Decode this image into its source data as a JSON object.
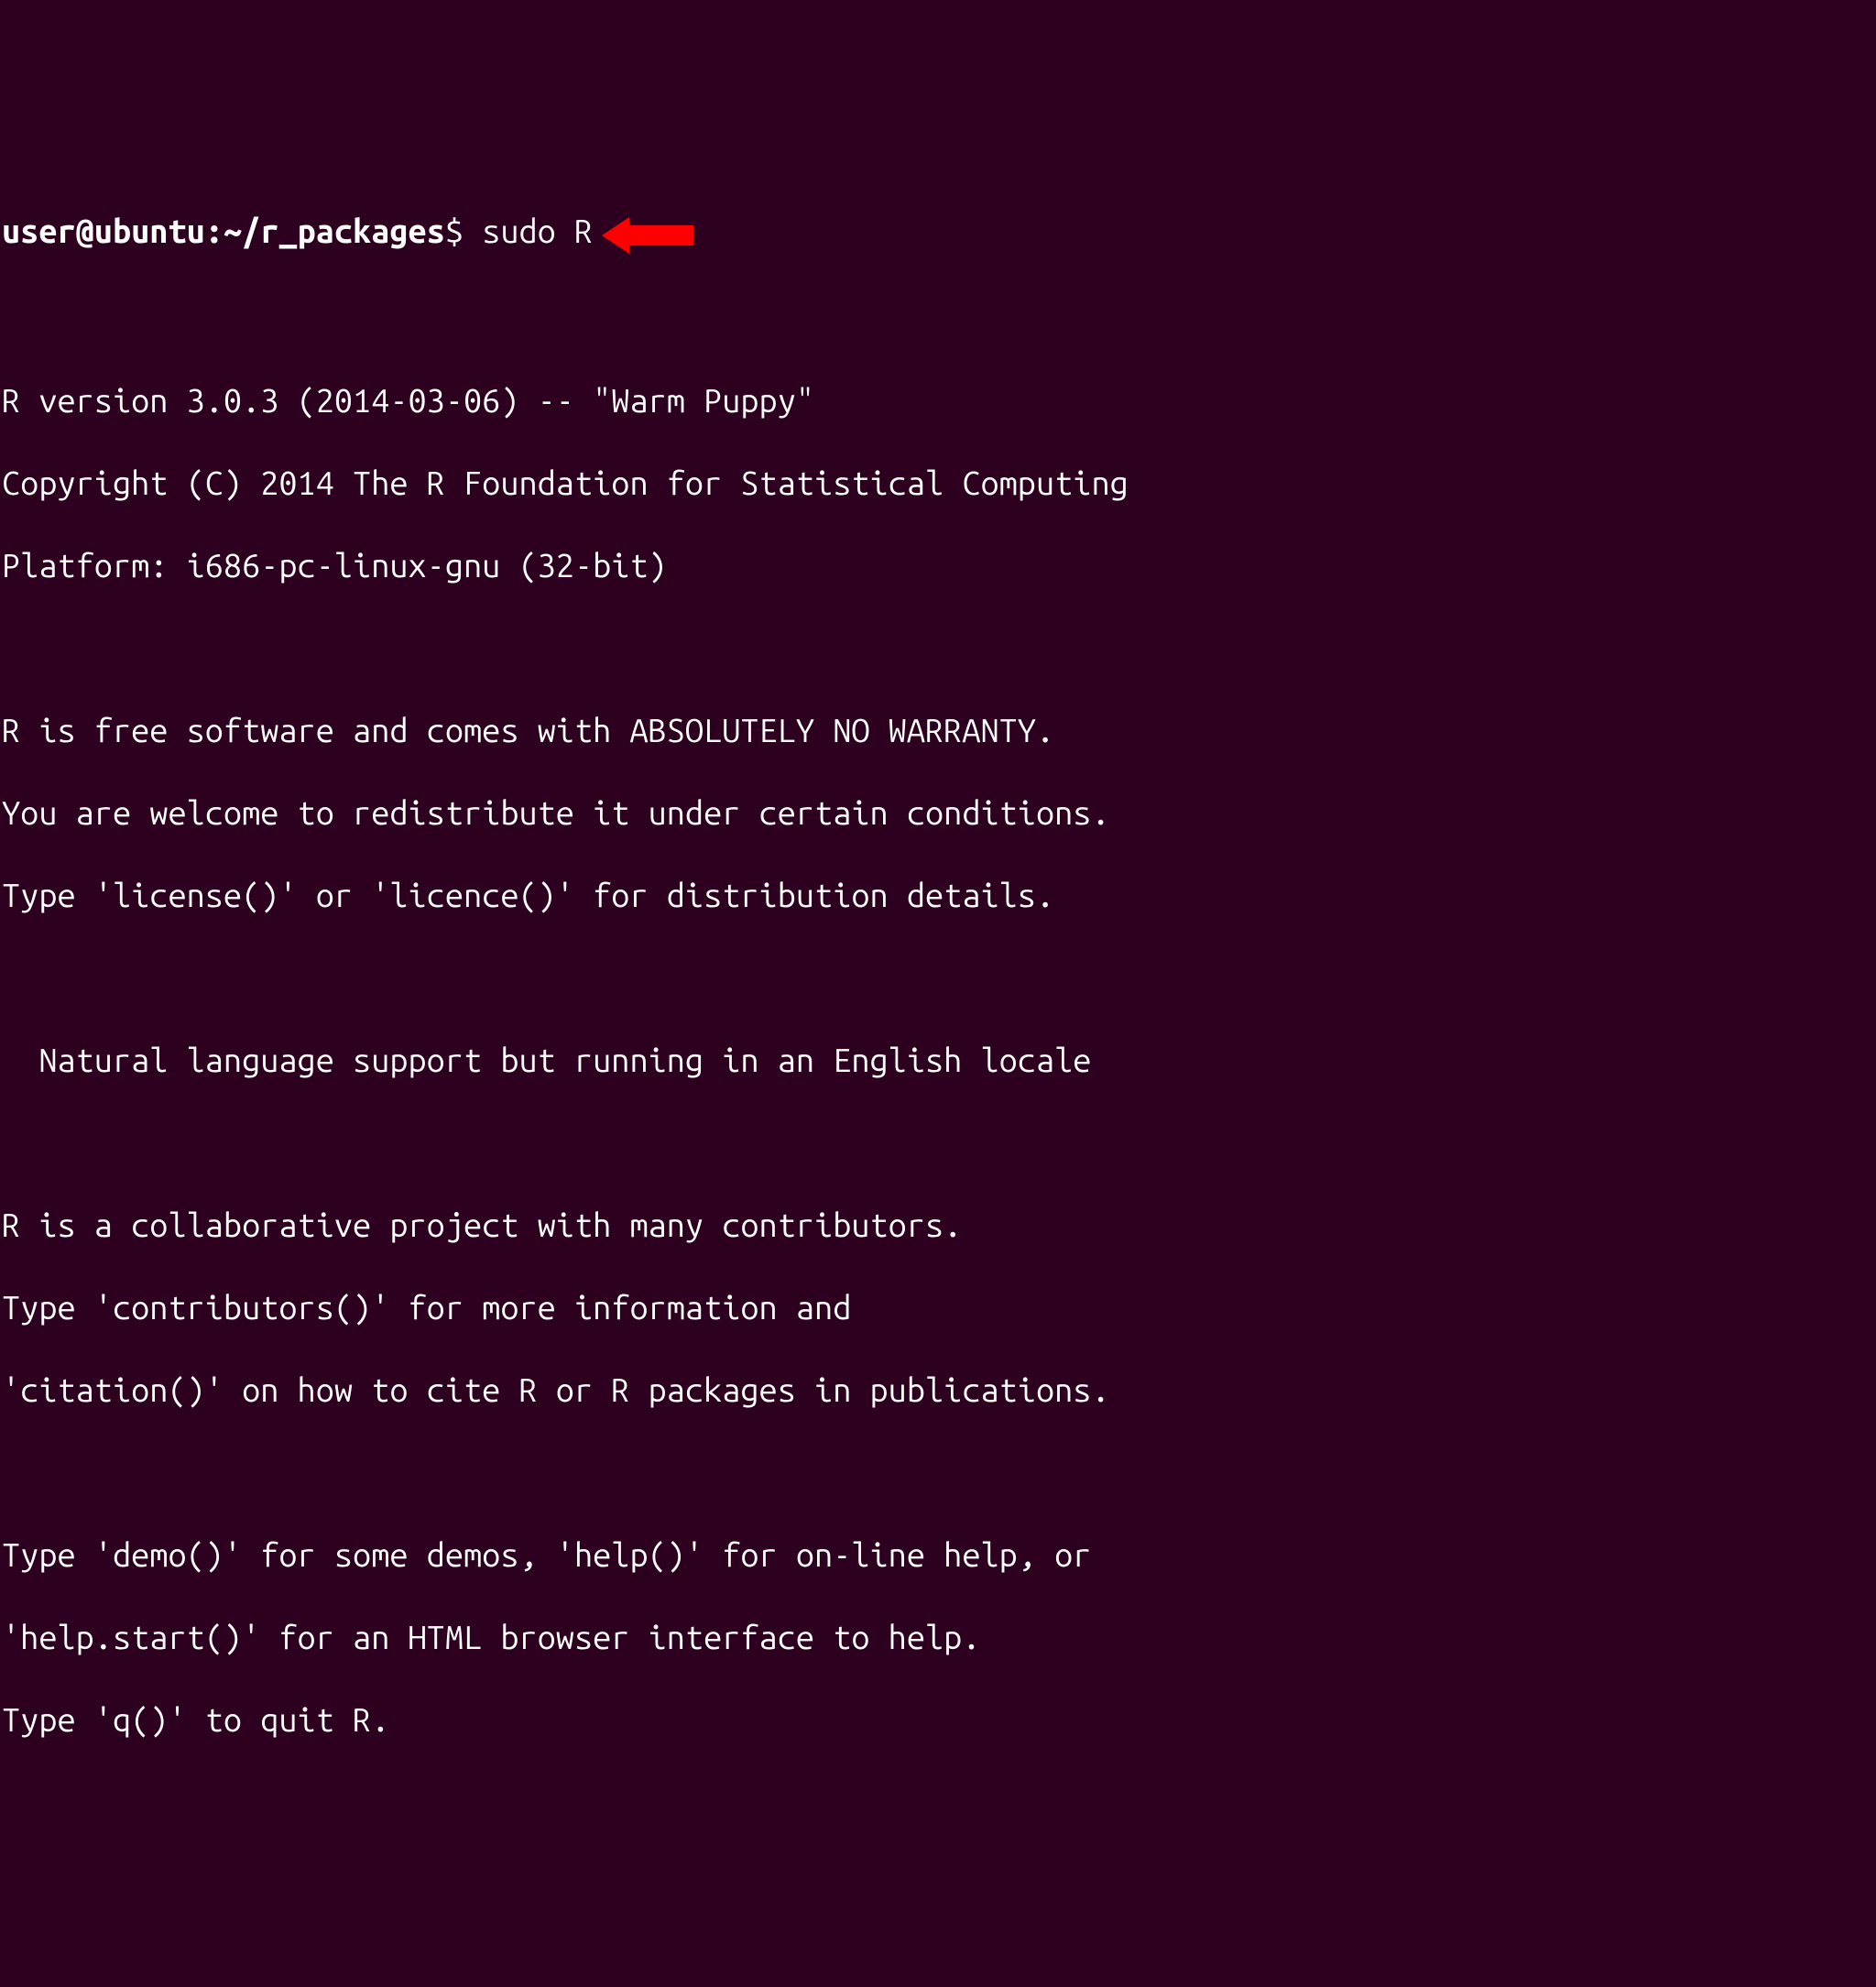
{
  "prompt": {
    "user_host": "user@ubuntu",
    "separator": ":",
    "path": "~/r_packages",
    "symbol": "$",
    "command": "sudo R"
  },
  "output": {
    "line1": "R version 3.0.3 (2014-03-06) -- \"Warm Puppy\"",
    "line2": "Copyright (C) 2014 The R Foundation for Statistical Computing",
    "line3": "Platform: i686-pc-linux-gnu (32-bit)",
    "line4": "R is free software and comes with ABSOLUTELY NO WARRANTY.",
    "line5": "You are welcome to redistribute it under certain conditions.",
    "line6": "Type 'license()' or 'licence()' for distribution details.",
    "line7": "  Natural language support but running in an English locale",
    "line8": "R is a collaborative project with many contributors.",
    "line9": "Type 'contributors()' for more information and",
    "line10": "'citation()' on how to cite R or R packages in publications.",
    "line11": "Type 'demo()' for some demos, 'help()' for on-line help, or",
    "line12": "'help.start()' for an HTML browser interface to help.",
    "line13": "Type 'q()' to quit R."
  },
  "annotation": {
    "arrow_color": "#ff0000"
  }
}
